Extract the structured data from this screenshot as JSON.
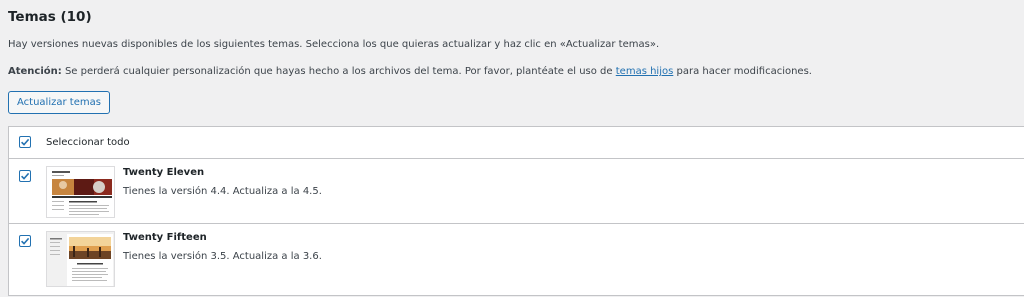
{
  "page": {
    "title": "Temas (10)",
    "intro": "Hay versiones nuevas disponibles de los siguientes temas. Selecciona los que quieras actualizar y haz clic en «Actualizar temas».",
    "warning_label": "Atención:",
    "warning_text_before": " Se perderá cualquier personalización que hayas hecho a los archivos del tema. Por favor, plantéate el uso de ",
    "warning_link": "temas hijos",
    "warning_text_after": " para hacer modificaciones.",
    "update_button": "Actualizar temas"
  },
  "table": {
    "select_all_label": "Seleccionar todo",
    "select_all_checked": true,
    "themes": [
      {
        "name": "Twenty Eleven",
        "status": "Tienes la versión 4.4. Actualiza a la 4.5.",
        "checked": true,
        "thumbnail_icon": "twenty-eleven-thumbnail"
      },
      {
        "name": "Twenty Fifteen",
        "status": "Tienes la versión 3.5. Actualiza a la 3.6.",
        "checked": true,
        "thumbnail_icon": "twenty-fifteen-thumbnail"
      }
    ]
  },
  "colors": {
    "background": "#f0f0f1",
    "accent": "#2271b1",
    "border": "#c3c4c7"
  }
}
